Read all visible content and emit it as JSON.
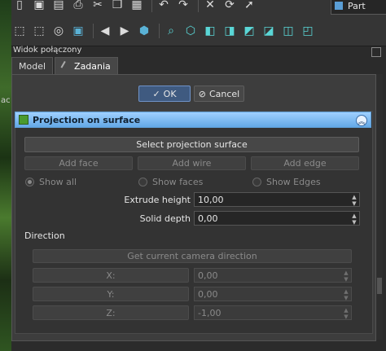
{
  "window": {
    "panel_title": "Widok połączony",
    "left_strip_text": [
      "ac"
    ]
  },
  "toolbar": {
    "workbench": "Part",
    "row1_icons": [
      "new-document-icon",
      "save-all-icon",
      "save-icon",
      "print-icon",
      "cut-icon",
      "copy-icon",
      "paste-icon",
      "undo-icon",
      "redo-icon",
      "tools-icon",
      "refresh-icon",
      "pointer-icon"
    ],
    "row2_icons": [
      "box-select-icon",
      "box-element-select-icon",
      "draw-style-icon",
      "bounding-box-icon",
      "back-arrow-icon",
      "forward-arrow-icon",
      "workbench-switch-icon",
      "zoom-icon",
      "isometric-view-icon",
      "front-view-icon",
      "top-view-icon",
      "right-view-icon",
      "rear-view-icon",
      "bottom-view-icon",
      "left-view-icon"
    ]
  },
  "tabs": [
    {
      "label": "Model",
      "active": false
    },
    {
      "label": "Zadania",
      "active": true
    }
  ],
  "dialog": {
    "ok_label": "OK",
    "cancel_label": "Cancel"
  },
  "projection": {
    "title": "Projection on surface",
    "select_surface_label": "Select projection surface",
    "add_face_label": "Add face",
    "add_wire_label": "Add wire",
    "add_edge_label": "Add edge",
    "show_all_label": "Show all",
    "show_faces_label": "Show faces",
    "show_edges_label": "Show Edges",
    "extrude_height_label": "Extrude height",
    "extrude_height_value": "10,00",
    "solid_depth_label": "Solid depth",
    "solid_depth_value": "0,00",
    "direction_label": "Direction",
    "camera_direction_label": "Get current camera direction",
    "x_label": "X:",
    "x_value": "0,00",
    "y_label": "Y:",
    "y_value": "0,00",
    "z_label": "Z:",
    "z_value": "-1,00"
  },
  "colors": {
    "header_blue": "#63a8e6",
    "ok_accent": "#6f93c8",
    "panel_bg": "#3d3d3d"
  }
}
